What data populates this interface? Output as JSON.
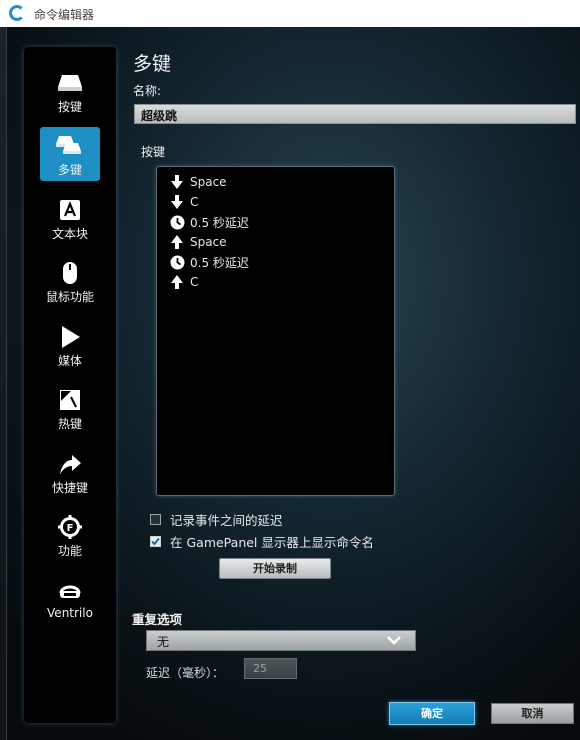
{
  "window": {
    "title": "命令编辑器"
  },
  "sidebar": {
    "items": [
      {
        "label": "按键",
        "icon": "key-icon"
      },
      {
        "label": "多键",
        "icon": "multi-key-icon",
        "active": true
      },
      {
        "label": "文本块",
        "icon": "text-block-icon"
      },
      {
        "label": "鼠标功能",
        "icon": "mouse-icon"
      },
      {
        "label": "媒体",
        "icon": "play-icon"
      },
      {
        "label": "热键",
        "icon": "hotkey-icon"
      },
      {
        "label": "快捷键",
        "icon": "shortcut-arrow-icon"
      },
      {
        "label": "功能",
        "icon": "function-icon"
      },
      {
        "label": "Ventrilo",
        "icon": "headset-icon"
      }
    ]
  },
  "main": {
    "heading": "多键",
    "name_label": "名称:",
    "name_value": "超级跳",
    "keys_label": "按键",
    "key_events": [
      {
        "icon": "arrow-down-icon",
        "text": "Space"
      },
      {
        "icon": "arrow-down-icon",
        "text": "C"
      },
      {
        "icon": "clock-icon",
        "text": "0.5 秒延迟"
      },
      {
        "icon": "arrow-up-icon",
        "text": "Space"
      },
      {
        "icon": "clock-icon",
        "text": "0.5 秒延迟"
      },
      {
        "icon": "arrow-up-icon",
        "text": "C"
      }
    ],
    "record_delays": {
      "label": "记录事件之间的延迟",
      "checked": false
    },
    "show_name": {
      "label": "在 GamePanel 显示器上显示命令名",
      "checked": true
    },
    "record_button": "开始录制",
    "repeat_label": "重复选项",
    "repeat_value": "无",
    "delay_label": "延迟（毫秒）：",
    "delay_value": "25"
  },
  "footer": {
    "ok": "确定",
    "cancel": "取消"
  },
  "colors": {
    "accent": "#1d8fc4",
    "panel": "#000000"
  }
}
